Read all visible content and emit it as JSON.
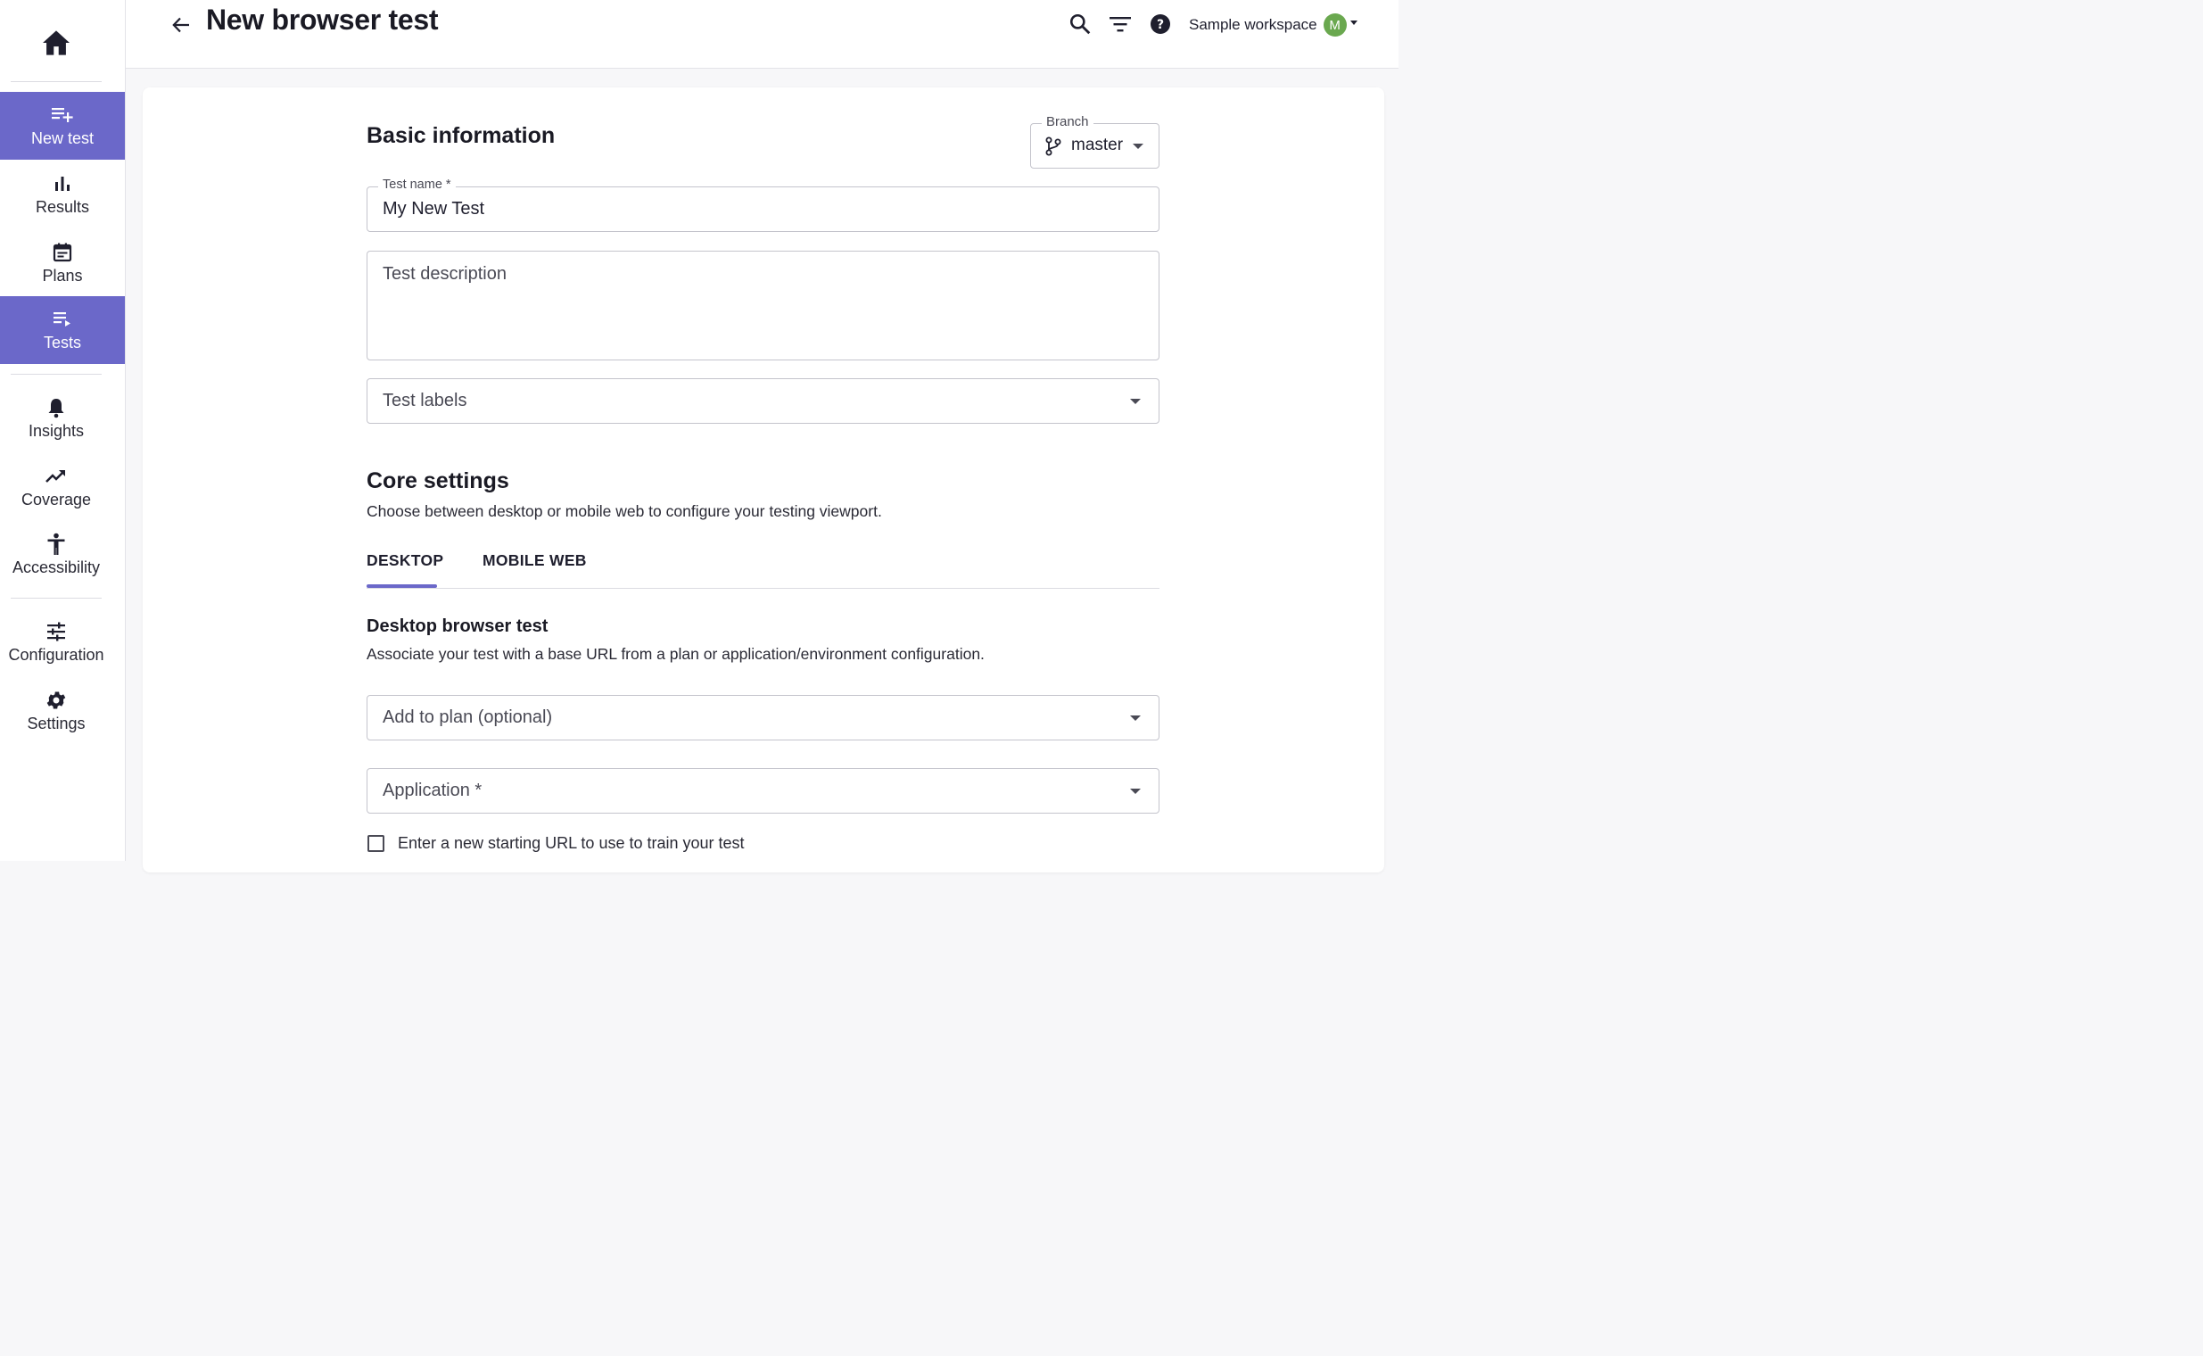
{
  "sidebar": {
    "items": [
      {
        "label": "New test",
        "icon": "playlist-add-icon",
        "active": true
      },
      {
        "label": "Results",
        "icon": "bar-chart-icon",
        "active": false
      },
      {
        "label": "Plans",
        "icon": "calendar-icon",
        "active": false
      },
      {
        "label": "Tests",
        "icon": "playlist-play-icon",
        "active": true
      },
      {
        "label": "Insights",
        "icon": "bell-icon",
        "active": false
      },
      {
        "label": "Coverage",
        "icon": "trending-up-icon",
        "active": false
      },
      {
        "label": "Accessibility",
        "icon": "accessibility-icon",
        "active": false
      },
      {
        "label": "Configuration",
        "icon": "tune-icon",
        "active": false
      },
      {
        "label": "Settings",
        "icon": "gear-icon",
        "active": false
      }
    ],
    "active_color": "#6b68c9"
  },
  "header": {
    "title": "New browser test",
    "workspace_name": "Sample workspace",
    "avatar_initial": "M",
    "avatar_color": "#6aa84f"
  },
  "basic_info": {
    "title": "Basic information",
    "branch_label": "Branch",
    "branch_value": "master",
    "test_name_label": "Test name *",
    "test_name_value": "My New Test",
    "description_placeholder": "Test description",
    "labels_placeholder": "Test labels"
  },
  "core_settings": {
    "title": "Core settings",
    "description": "Choose between desktop or mobile web to configure your testing viewport.",
    "tabs": [
      {
        "label": "DESKTOP",
        "selected": true
      },
      {
        "label": "MOBILE WEB",
        "selected": false
      }
    ]
  },
  "desktop_test": {
    "title": "Desktop browser test",
    "description": "Associate your test with a base URL from a plan or application/environment configuration.",
    "plan_placeholder": "Add to plan (optional)",
    "application_placeholder": "Application *",
    "checkbox_label": "Enter a new starting URL to use to train your test"
  }
}
